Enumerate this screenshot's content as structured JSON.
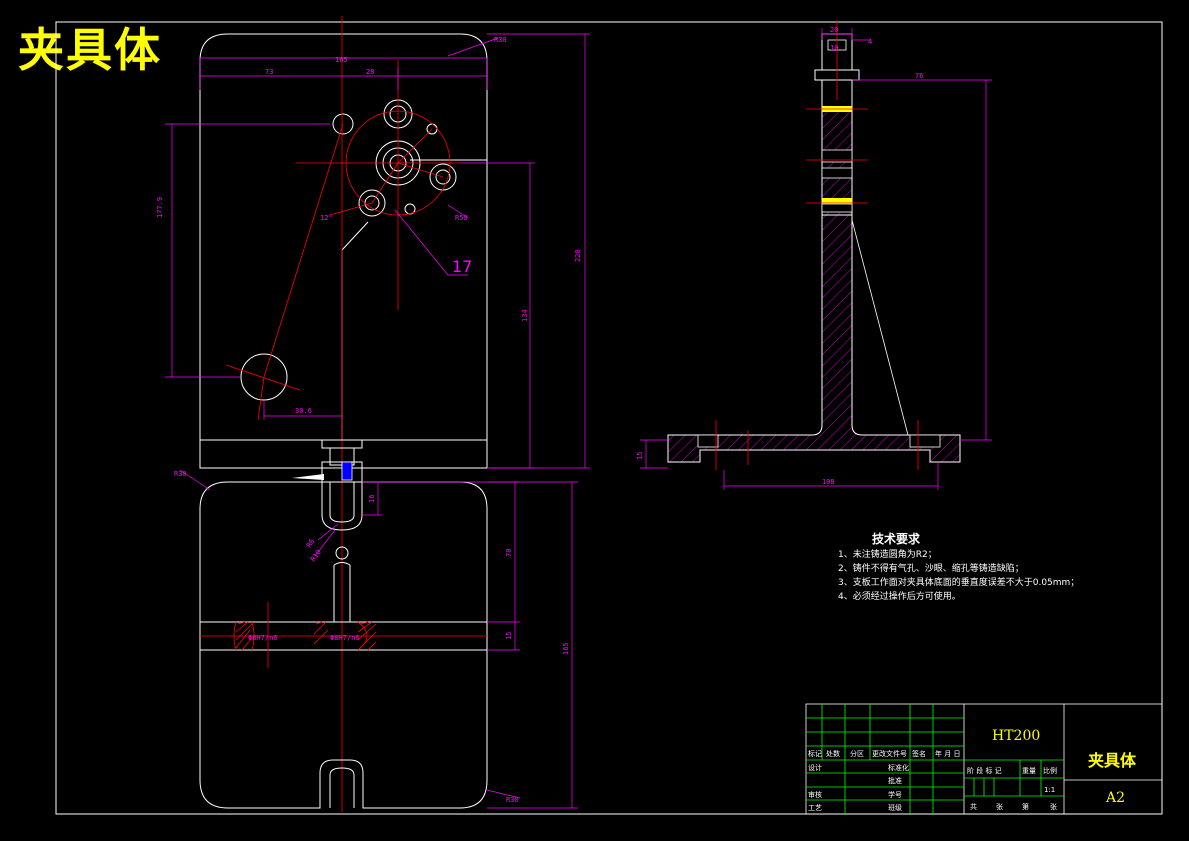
{
  "drawing": {
    "title_overlay": "夹具体",
    "colors": {
      "background": "#000000",
      "outline": "#ffffff",
      "dimension": "#ff00ff",
      "centerline": "#ff0000",
      "hatch": "#ff00ff",
      "highlight": "#ffff00",
      "titleblock_grid": "#00ff00"
    },
    "front_view": {
      "dims": {
        "w165": "165",
        "d73": "73",
        "d28": "28",
        "r30": "R30",
        "h177": "177.9",
        "h228": "228",
        "h134": "134",
        "d30_6": "30.6",
        "ang12": "12°",
        "r50": "R50",
        "callout": "17"
      }
    },
    "top_view": {
      "dims": {
        "r30a": "R30",
        "d16": "16",
        "r6": "R6",
        "r10": "R10",
        "d70": "70",
        "d15": "15",
        "h165": "165",
        "fit1": "Φ8H7/n6",
        "fit2": "Φ8H7/n6",
        "r30b": "R30"
      }
    },
    "side_view": {
      "dims": {
        "d20": "20",
        "d10": "10",
        "d4": "4",
        "d76": "76",
        "d15": "15",
        "d108": "108"
      }
    },
    "tech_notes": {
      "title": "技术要求",
      "items": [
        "1、未注铸造圆角为R2；",
        "2、铸件不得有气孔、沙眼、缩孔等铸造缺陷；",
        "3、支板工作面对夹具体底面的垂直度误差不大于0.05mm；",
        "4、必须经过操作后方可使用。"
      ]
    },
    "title_block": {
      "material": "HT200",
      "part_name": "夹具体",
      "sheet_size": "A2",
      "scale": "1:1",
      "header_cells": [
        "标记",
        "处数",
        "分区",
        "更改文件号",
        "签名",
        "年 月 日"
      ],
      "left_labels": [
        "设计",
        "审核",
        "工艺"
      ],
      "mid_labels": [
        "标准化",
        "批准",
        "学号",
        "班级"
      ],
      "stage_labels": [
        "阶 段 标 记",
        "重量",
        "比例"
      ],
      "sheet_info": [
        "共",
        "张",
        "第",
        "张"
      ]
    }
  }
}
